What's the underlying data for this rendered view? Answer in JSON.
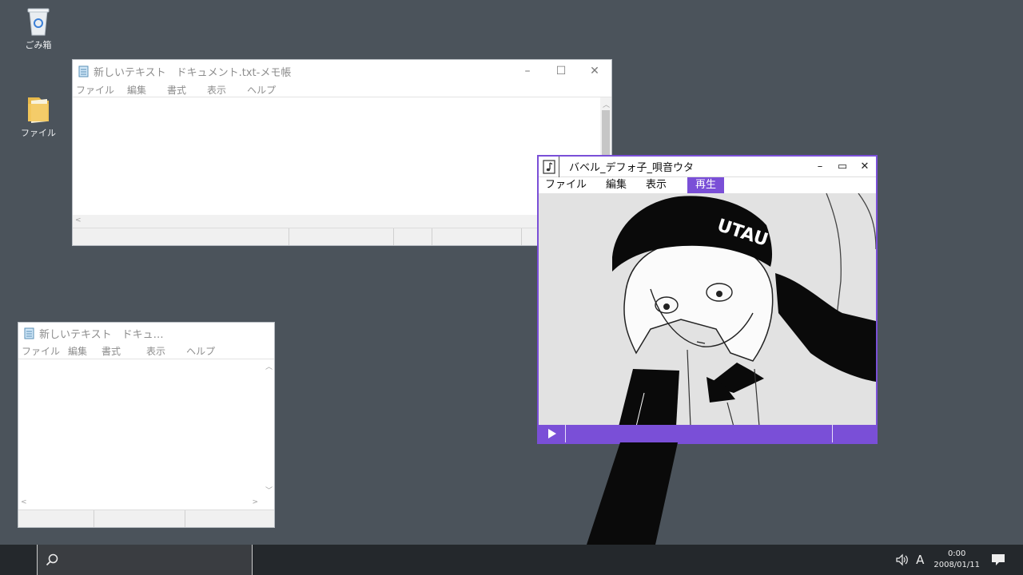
{
  "desktop": {
    "icons": [
      {
        "label": "ごみ箱",
        "icon": "recycle-bin-icon"
      },
      {
        "label": "ファイル",
        "icon": "folder-icon"
      }
    ]
  },
  "notepad_main": {
    "title": "新しいテキスト　ドキュメント.txt-メモ帳",
    "menu": [
      "ファイル",
      "編集",
      "書式",
      "表示",
      "ヘルプ"
    ],
    "controls": {
      "minimize": "–",
      "maximize": "☐",
      "close": "✕"
    }
  },
  "notepad_small": {
    "title": "新しいテキスト　ドキュ…",
    "menu": [
      "ファイル",
      "編集",
      "書式",
      "表示",
      "ヘルプ"
    ]
  },
  "player": {
    "title": "バベル_デフォ子_唄音ウタ",
    "menu": [
      "ファイル",
      "編集",
      "表示",
      "再生"
    ],
    "active_menu": "再生",
    "hat_text": "UTAU",
    "controls": {
      "minimize": "–",
      "maximize": "▭",
      "close": "✕"
    },
    "accent": "#7a4fd7"
  },
  "taskbar": {
    "ime": "A",
    "time": "0:00",
    "date": "2008/01/11"
  }
}
